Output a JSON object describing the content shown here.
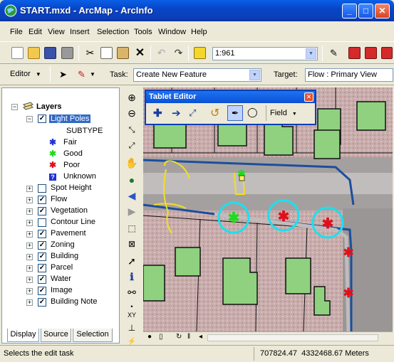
{
  "window": {
    "title": "START.mxd - ArcMap - ArcInfo",
    "minimize": "_",
    "maximize": "□",
    "close": "✕"
  },
  "menu": [
    "File",
    "Edit",
    "View",
    "Insert",
    "Selection",
    "Tools",
    "Window",
    "Help"
  ],
  "toolbar": {
    "scale": "1:961",
    "editor_label": "Editor",
    "task_label": "Task:",
    "task_value": "Create New Feature",
    "target_label": "Target:",
    "target_value": "Flow : Primary View"
  },
  "toc": {
    "root": "Layers",
    "light_poles": {
      "name": "Light Poles",
      "subtype_header": "SUBTYPE",
      "legend": [
        {
          "label": "Fair",
          "symbol": "✱",
          "color": "#1F2FD8"
        },
        {
          "label": "Good",
          "symbol": "✱",
          "color": "#22D822"
        },
        {
          "label": "Poor",
          "symbol": "✱",
          "color": "#E0101A"
        },
        {
          "label": "Unknown",
          "symbol": "?",
          "color": "#1F2FD8"
        }
      ]
    },
    "layers": [
      {
        "name": "Spot Height",
        "checked": false
      },
      {
        "name": "Flow",
        "checked": true
      },
      {
        "name": "Vegetation",
        "checked": true
      },
      {
        "name": "Contour Line",
        "checked": false
      },
      {
        "name": "Pavement",
        "checked": true
      },
      {
        "name": "Zoning",
        "checked": true
      },
      {
        "name": "Building",
        "checked": true
      },
      {
        "name": "Parcel",
        "checked": true
      },
      {
        "name": "Water",
        "checked": true
      },
      {
        "name": "Image",
        "checked": true
      },
      {
        "name": "Building Note",
        "checked": true
      }
    ],
    "tabs": [
      "Display",
      "Source",
      "Selection"
    ]
  },
  "tablet_editor": {
    "title": "Tablet Editor",
    "field_label": "Field"
  },
  "status": {
    "message": "Selects the edit task",
    "coordinates": "707824.47  4332468.67 Meters"
  },
  "map_tools": {
    "xy_label": "XY"
  },
  "colors": {
    "building": "#8FD17F",
    "flow_line": "#1C4E9C",
    "circle": "#1CE0EE",
    "poor": "#E0101A",
    "good": "#22D822",
    "sketch": "#F0E020"
  }
}
